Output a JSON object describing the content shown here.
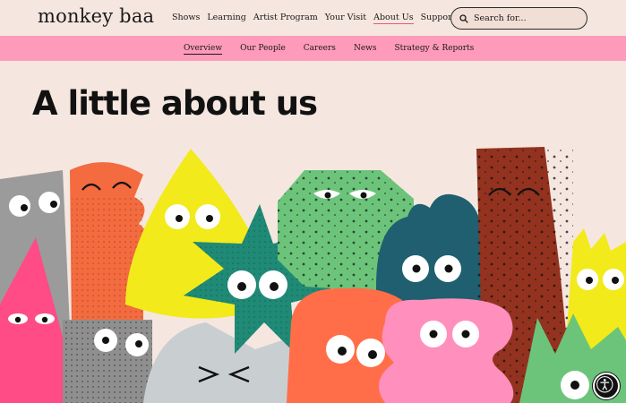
{
  "brand": {
    "logo_text": "monkey baa"
  },
  "main_nav": {
    "items": [
      {
        "label": "Shows"
      },
      {
        "label": "Learning"
      },
      {
        "label": "Artist Program"
      },
      {
        "label": "Your Visit"
      },
      {
        "label": "About Us",
        "active": true
      },
      {
        "label": "Support Us"
      }
    ]
  },
  "search": {
    "placeholder": "Search for..."
  },
  "sub_nav": {
    "items": [
      {
        "label": "Overview",
        "active": true
      },
      {
        "label": "Our People"
      },
      {
        "label": "Careers"
      },
      {
        "label": "News"
      },
      {
        "label": "Strategy & Reports"
      }
    ]
  },
  "hero": {
    "title": "A little about us"
  },
  "colors": {
    "page_bg": "#f5e7df",
    "subnav_bg": "#ff9bba",
    "active_underline": "#e8577a"
  },
  "icons": {
    "search": "search-icon",
    "accessibility": "accessibility-icon"
  }
}
